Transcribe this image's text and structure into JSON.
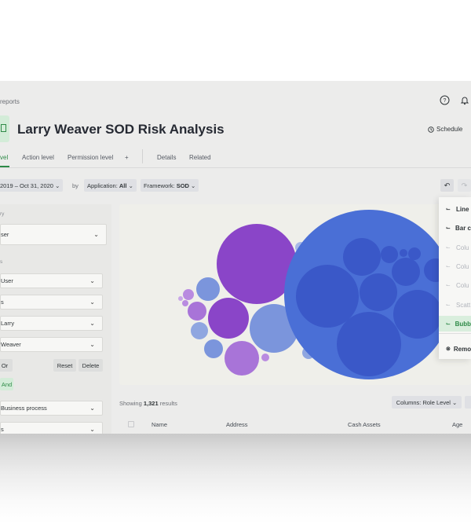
{
  "breadcrumb": "reports",
  "page_title": "Larry Weaver SOD Risk Analysis",
  "schedule_label": "Schedule",
  "tabs": [
    "vel",
    "Action level",
    "Permission level",
    "+",
    "Details",
    "Related"
  ],
  "filters": {
    "date_range": "2019 – Oct 31, 2020",
    "by": "by",
    "application_label": "Application:",
    "application_value": "All",
    "framework_label": "Framework:",
    "framework_value": "SOD"
  },
  "sidebar": {
    "label1": "ry",
    "select1": "ser",
    "label2": "s",
    "selects": [
      "User",
      "s",
      "Larry",
      "Weaver"
    ],
    "or_label": "Or",
    "reset_label": "Reset",
    "delete_label": "Delete",
    "and_label": "And",
    "selects2": [
      "Business process",
      "s"
    ]
  },
  "chart_menu": {
    "items": [
      "Line",
      "Bar c",
      "Colu",
      "Colu",
      "Colu",
      "Scatt",
      "Bubb"
    ],
    "remove": "Remo"
  },
  "results": {
    "showing_prefix": "Showing",
    "count": "1,321",
    "suffix": "results",
    "columns_label": "Columns:",
    "columns_value": "Role Level"
  },
  "table_headers": [
    "Name",
    "Address",
    "Cash Assets",
    "Age"
  ],
  "colors": {
    "accent_green": "#2e8a47",
    "purple": "#8a45c8",
    "blue": "#4a6fd6"
  }
}
